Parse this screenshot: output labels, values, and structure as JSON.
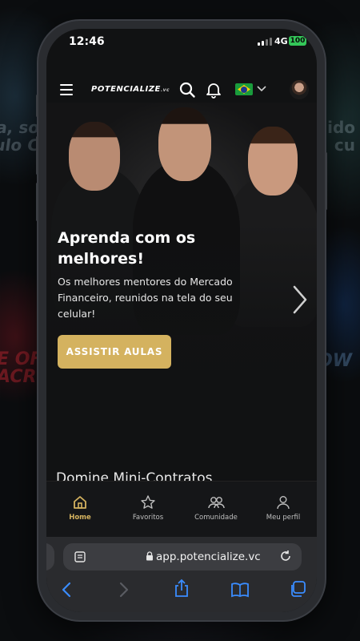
{
  "status": {
    "time": "12:46",
    "network": "4G",
    "battery": "100"
  },
  "header": {
    "logo": "POTENCIALIZE",
    "logo_suffix": ".vc"
  },
  "hero": {
    "title": "Aprenda com os melhores!",
    "subtitle": "Os melhores mentores do Mercado Financeiro, reunidos na tela do seu celular!",
    "cta_label": "ASSISTIR AULAS"
  },
  "next_section": {
    "title": "Domine Mini-Contratos"
  },
  "tabs": [
    {
      "label": "Home",
      "icon": "home-icon",
      "active": true
    },
    {
      "label": "Favoritos",
      "icon": "star-icon",
      "active": false
    },
    {
      "label": "Comunidade",
      "icon": "community-icon",
      "active": false
    },
    {
      "label": "Meu perfil",
      "icon": "profile-icon",
      "active": false
    }
  ],
  "browser": {
    "url": "app.potencialize.vc"
  },
  "background": {
    "left_text": "a, sou\nulo Co",
    "right_text": "uido\ncu",
    "left_red_text": "E OF\nACR",
    "right_blue_text": "OW"
  },
  "colors": {
    "accent": "#d4b25f",
    "background": "#111213",
    "tabbar": "#151618",
    "browser": "#2a2b2e"
  }
}
